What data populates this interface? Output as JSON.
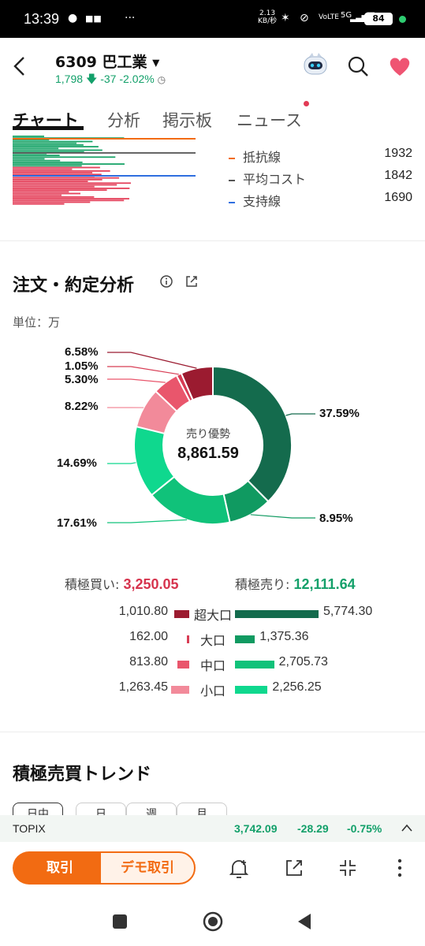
{
  "status_bar": {
    "time": "13:39",
    "net_speed_top": "2.13",
    "net_speed_bottom": "KB/秒",
    "signal_label": "5G",
    "battery": "84"
  },
  "header": {
    "title": "6309 巴工業",
    "price": "1,798",
    "change": "-37",
    "change_pct": "-2.02%"
  },
  "tabs": [
    {
      "label": "チャート",
      "active": true
    },
    {
      "label": "分析",
      "active": false
    },
    {
      "label": "掲示板",
      "active": false
    },
    {
      "label": "ニュース",
      "active": false
    }
  ],
  "price_lines": [
    {
      "label": "抵抗線",
      "value": "1932",
      "color": "#f26b12"
    },
    {
      "label": "平均コスト",
      "value": "1842",
      "color": "#555555"
    },
    {
      "label": "支持線",
      "value": "1690",
      "color": "#2f6fe0"
    }
  ],
  "order_analysis": {
    "title": "注文・約定分析",
    "unit": "単位：万",
    "center_label": "売り優勢",
    "center_value": "8,861.59",
    "buy_label": "積極買い:",
    "buy_value": "3,250.05",
    "sell_label": "積極売り:",
    "sell_value": "12,111.64"
  },
  "chart_data": {
    "type": "pie",
    "title": "",
    "donut": true,
    "slices": [
      {
        "label": "超大口 売り",
        "value": 37.59,
        "color": "#146b4d"
      },
      {
        "label": "大口 売り",
        "value": 8.95,
        "color": "#109a61"
      },
      {
        "label": "中口 売り",
        "value": 17.61,
        "color": "#10c27a"
      },
      {
        "label": "小口 売り",
        "value": 14.69,
        "color": "#0fd88e"
      },
      {
        "label": "小口 買い",
        "value": 8.22,
        "color": "#f28a9a"
      },
      {
        "label": "中口 買い",
        "value": 5.3,
        "color": "#e9566c"
      },
      {
        "label": "大口 買い",
        "value": 1.05,
        "color": "#d83d55"
      },
      {
        "label": "超大口 買い",
        "value": 6.58,
        "color": "#9b1b30"
      }
    ],
    "pct_labels": [
      "37.59%",
      "8.95%",
      "17.61%",
      "14.69%",
      "8.22%",
      "5.30%",
      "1.05%",
      "6.58%"
    ]
  },
  "breakdown": [
    {
      "label": "超大口",
      "buy": "1,010.80",
      "sell": "5,774.30",
      "buy_value": 1010.8,
      "sell_value": 5774.3,
      "buy_color": "#9b1b30",
      "sell_color": "#146b4d"
    },
    {
      "label": "大口",
      "buy": "162.00",
      "sell": "1,375.36",
      "buy_value": 162.0,
      "sell_value": 1375.36,
      "buy_color": "#d83d55",
      "sell_color": "#109a61"
    },
    {
      "label": "中口",
      "buy": "813.80",
      "sell": "2,705.73",
      "buy_value": 813.8,
      "sell_value": 2705.73,
      "buy_color": "#e9566c",
      "sell_color": "#10c27a"
    },
    {
      "label": "小口",
      "buy": "1,263.45",
      "sell": "2,256.25",
      "buy_value": 1263.45,
      "sell_value": 2256.25,
      "buy_color": "#f28a9a",
      "sell_color": "#0fd88e"
    }
  ],
  "trend": {
    "title": "積極売買トレンド",
    "tabs": [
      "日中",
      "日",
      "週",
      "月"
    ]
  },
  "topix": {
    "name": "TOPIX",
    "value": "3,742.09",
    "change": "-28.29",
    "change_pct": "-0.75%"
  },
  "toolbar": {
    "trade_label": "取引",
    "demo_label": "デモ取引"
  }
}
